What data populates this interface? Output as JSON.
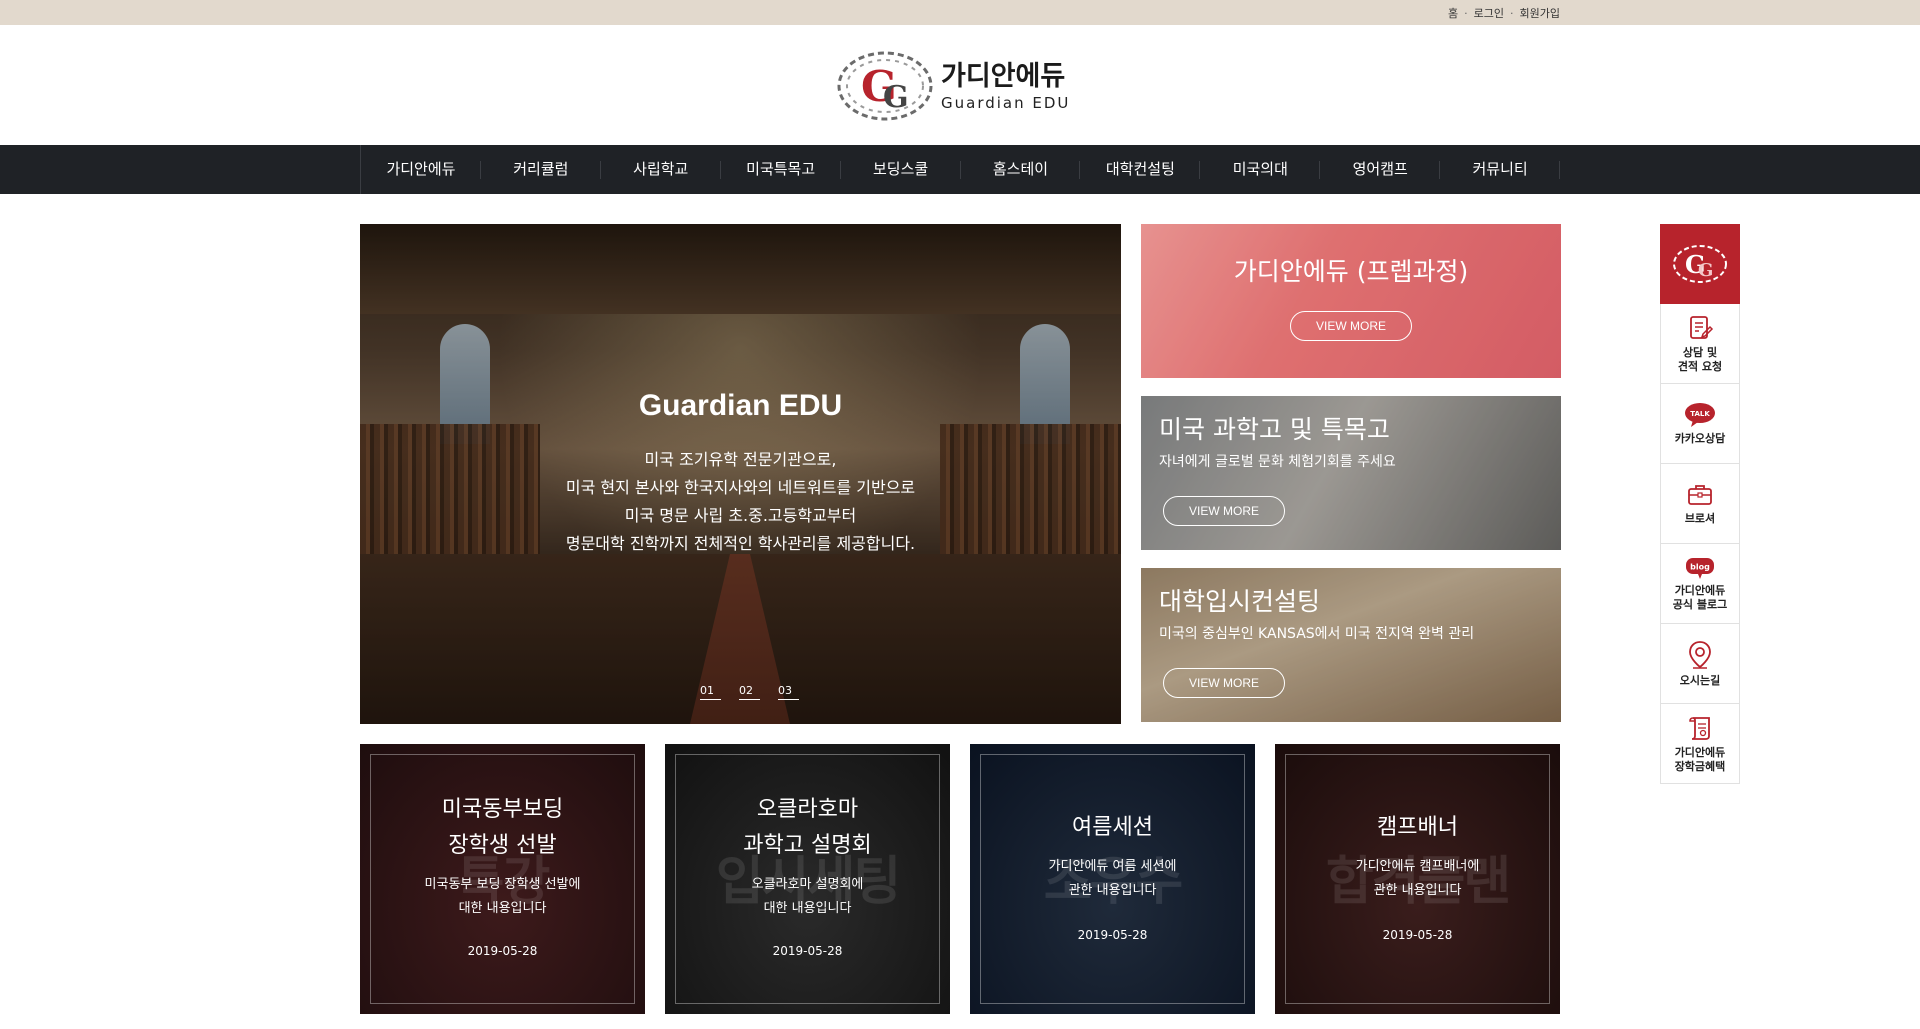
{
  "topbar": {
    "home": "홈",
    "login": "로그인",
    "signup": "회원가입",
    "separator": "·"
  },
  "logo": {
    "ko": "가디안에듀",
    "en": "Guardian EDU",
    "accent": "#b7232c"
  },
  "nav": {
    "items": [
      "가디안에듀",
      "커리큘럼",
      "사립학교",
      "미국특목고",
      "보딩스쿨",
      "홈스테이",
      "대학컨설팅",
      "미국의대",
      "영어캠프",
      "커뮤니티"
    ]
  },
  "hero": {
    "title": "Guardian EDU",
    "lines": [
      "미국 조기유학 전문기관으로,",
      "미국 현지 본사와 한국지사와의 네트워트를 기반으로",
      "미국 명문 사립 초.중.고등학교부터",
      "명문대학 진학까지 전체적인 학사관리를 제공합니다."
    ],
    "pager": [
      "01",
      "02",
      "03"
    ]
  },
  "promos": [
    {
      "title": "가디안에듀 (프렙과정)",
      "subtitle": "",
      "button": "VIEW MORE"
    },
    {
      "title": "미국 과학고 및 특목고",
      "subtitle": "자녀에게 글로벌 문화 체험기회를 주세요",
      "button": "VIEW MORE"
    },
    {
      "title": "대학입시컨설팅",
      "subtitle": "미국의 중심부인 KANSAS에서 미국 전지역 완벽 관리",
      "button": "VIEW MORE"
    }
  ],
  "cards": [
    {
      "title1": "미국동부보딩",
      "title2": "장학생 선발",
      "desc1": "미국동부 보딩 장학생 선발에",
      "desc2": "대한 내용입니다",
      "date": "2019-05-28",
      "ghost": "특강"
    },
    {
      "title1": "오클라호마",
      "title2": "과학고 설명회",
      "desc1": "오클라호마 설명회에",
      "desc2": "대한 내용입니다",
      "date": "2019-05-28",
      "ghost": "입시세팅"
    },
    {
      "title1": "",
      "title2": "여름세션",
      "desc1": "가디안에듀 여름 세션에",
      "desc2": "관한 내용입니다",
      "date": "2019-05-28",
      "ghost": "조우수"
    },
    {
      "title1": "",
      "title2": "캠프배너",
      "desc1": "가디안에듀 캠프배너에",
      "desc2": "관한 내용입니다",
      "date": "2019-05-28",
      "ghost": "합격플랜"
    }
  ],
  "quickmenu": {
    "items": [
      {
        "label": "상담 및\n견적 요청",
        "icon": "document-edit-icon"
      },
      {
        "label": "카카오상담",
        "icon": "kakao-talk-icon"
      },
      {
        "label": "브로셔",
        "icon": "briefcase-icon"
      },
      {
        "label": "가디안에듀\n공식 블로그",
        "icon": "blog-icon"
      },
      {
        "label": "오시는길",
        "icon": "location-pin-icon"
      },
      {
        "label": "가디안에듀\n장학금혜택",
        "icon": "scroll-icon"
      }
    ],
    "kakao_badge": "TALK",
    "blog_badge": "blog"
  }
}
